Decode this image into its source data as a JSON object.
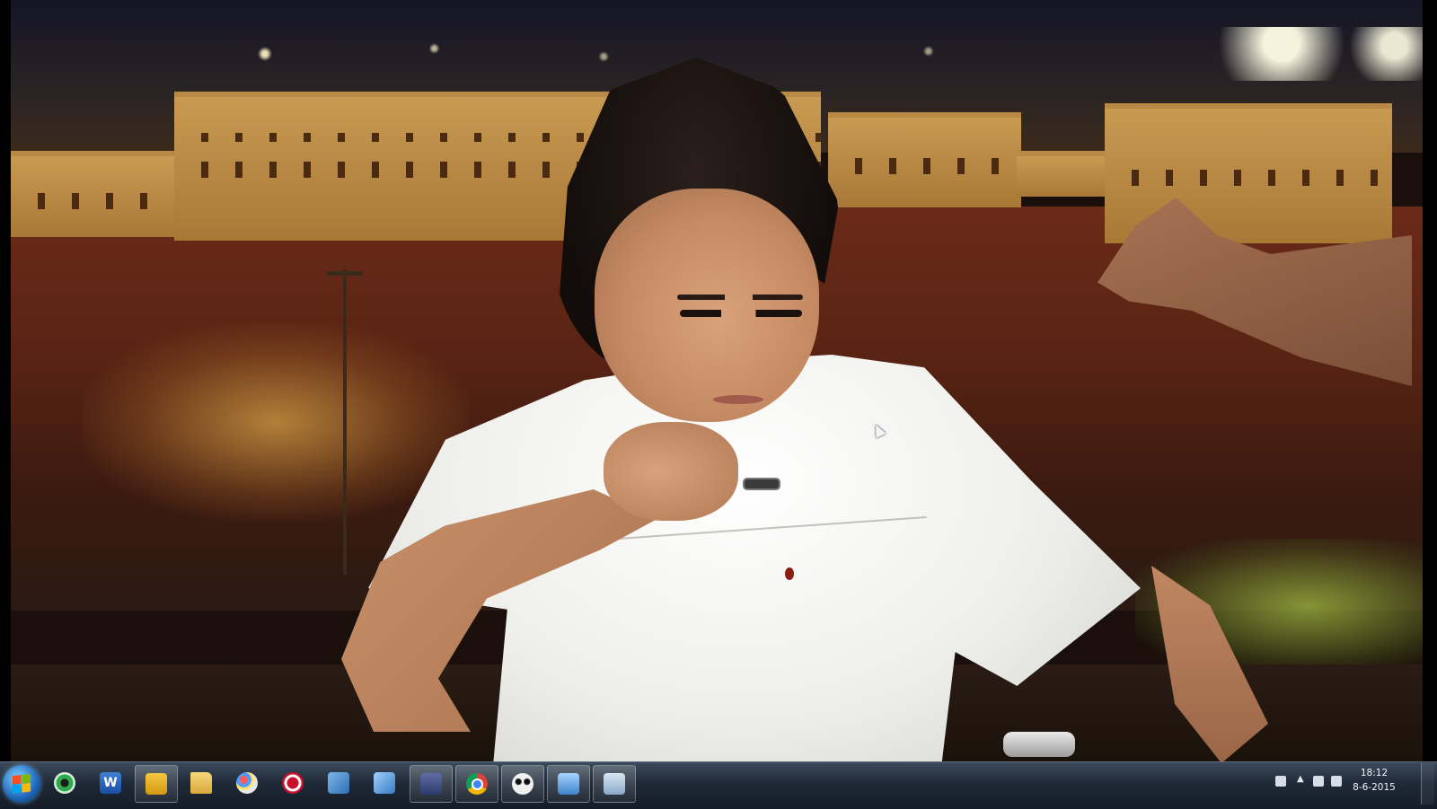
{
  "taskbar": {
    "items": [
      {
        "name": "eye-app-icon",
        "active": false
      },
      {
        "name": "word-icon",
        "label": "W",
        "active": false
      },
      {
        "name": "outlook-icon",
        "active": true
      },
      {
        "name": "file-explorer-icon",
        "active": false
      },
      {
        "name": "paint-icon",
        "active": false
      },
      {
        "name": "ccleaner-icon",
        "active": false
      },
      {
        "name": "network-icon",
        "active": false
      },
      {
        "name": "remote-desktop-icon",
        "active": false
      },
      {
        "name": "floppy-save-icon",
        "active": true
      },
      {
        "name": "chrome-icon",
        "active": true
      },
      {
        "name": "panda-icon",
        "active": true
      },
      {
        "name": "window-app-icon",
        "active": true
      },
      {
        "name": "display-icon",
        "active": true
      }
    ]
  },
  "tray": {
    "icons": [
      "keyboard-icon",
      "show-hidden-icons-icon",
      "network-tray-icon",
      "security-tray-icon"
    ]
  },
  "clock": {
    "time": "18:12",
    "date": "8-6-2015"
  },
  "colors": {
    "taskbar_top": "#3b4a5c",
    "taskbar_bottom": "#141b26"
  }
}
